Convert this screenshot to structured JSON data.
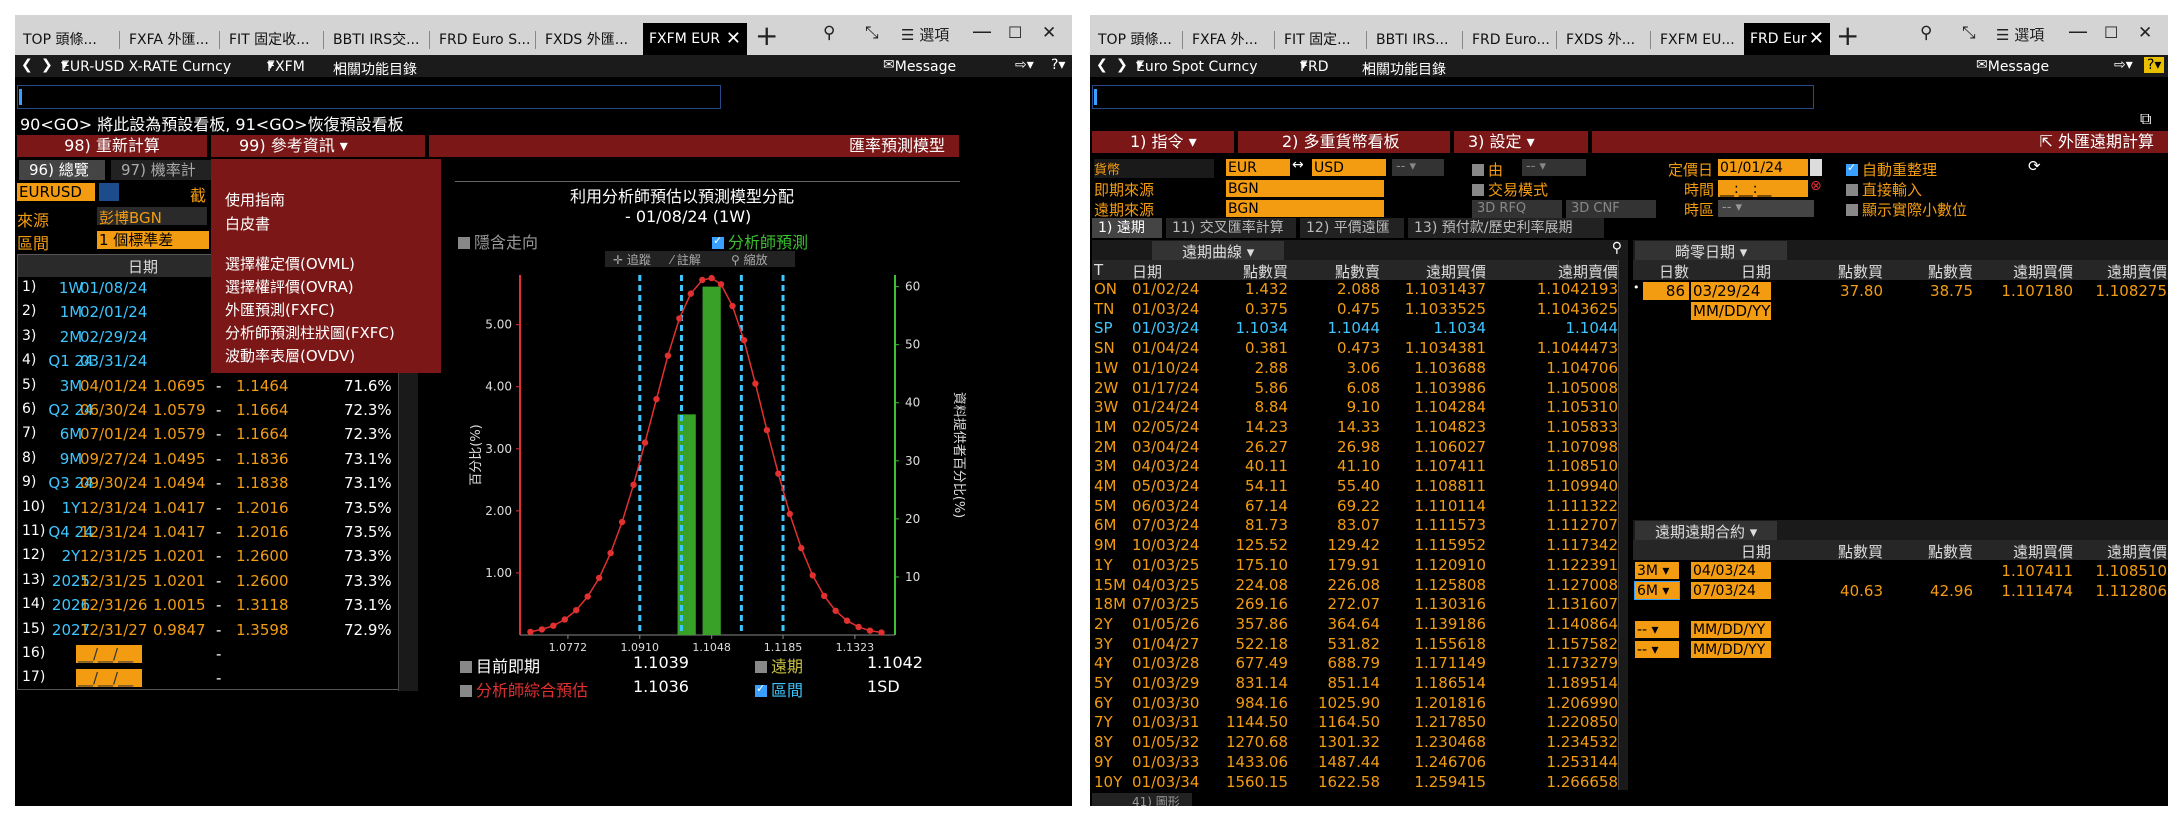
{
  "left": {
    "tabs": [
      "TOP 頭條...",
      "FXFA 外匯...",
      "FIT 固定收...",
      "BBTI IRS交...",
      "FRD Euro S...",
      "FXDS 外匯...",
      "FXFM EUR"
    ],
    "nav": {
      "security": "EUR-USD X-RATE Curncy",
      "function": "FXFM",
      "related": "相關功能目錄",
      "message": "Message"
    },
    "options_label": "選項",
    "hint": "90<GO> 將此設為預設看板, 91<GO>恢復預設看板",
    "menu": {
      "recalc": "98) 重新計算",
      "refinfo": "99) 參考資訊",
      "model": "匯率預測模型"
    },
    "subtabs": [
      "96) 總覽",
      "97) 機率計"
    ],
    "pair": "EURUSD",
    "pair_suffix": "截",
    "source_label": "來源",
    "source_value": "彭博BGN",
    "range_label": "區間",
    "range_value": "1 個標準差",
    "dropdown": [
      "使用指南",
      "白皮書",
      "選擇權定價(OVML)",
      "選擇權評價(OVRA)",
      "外匯預測(FXFC)",
      "分析師預測柱狀圖(FXFC)",
      "波動率表層(OVDV)"
    ],
    "table_header": "日期",
    "rows": [
      {
        "n": "1)",
        "t": "1W",
        "d": "01/08/24",
        "lo": "",
        "hi": "",
        "p": ""
      },
      {
        "n": "2)",
        "t": "1M",
        "d": "02/01/24",
        "lo": "",
        "hi": "",
        "p": ""
      },
      {
        "n": "3)",
        "t": "2M",
        "d": "02/29/24",
        "lo": "",
        "hi": "",
        "p": ""
      },
      {
        "n": "4)",
        "t": "Q1 24",
        "d": "03/31/24",
        "lo": "",
        "hi": "",
        "p": ""
      },
      {
        "n": "5)",
        "t": "3M",
        "d": "04/01/24",
        "lo": "1.0695",
        "hi": "1.1464",
        "p": "71.6%"
      },
      {
        "n": "6)",
        "t": "Q2 24",
        "d": "06/30/24",
        "lo": "1.0579",
        "hi": "1.1664",
        "p": "72.3%"
      },
      {
        "n": "7)",
        "t": "6M",
        "d": "07/01/24",
        "lo": "1.0579",
        "hi": "1.1664",
        "p": "72.3%"
      },
      {
        "n": "8)",
        "t": "9M",
        "d": "09/27/24",
        "lo": "1.0495",
        "hi": "1.1836",
        "p": "73.1%"
      },
      {
        "n": "9)",
        "t": "Q3 24",
        "d": "09/30/24",
        "lo": "1.0494",
        "hi": "1.1838",
        "p": "73.1%"
      },
      {
        "n": "10)",
        "t": "1Y",
        "d": "12/31/24",
        "lo": "1.0417",
        "hi": "1.2016",
        "p": "73.5%"
      },
      {
        "n": "11)",
        "t": "Q4 24",
        "d": "12/31/24",
        "lo": "1.0417",
        "hi": "1.2016",
        "p": "73.5%"
      },
      {
        "n": "12)",
        "t": "2Y",
        "d": "12/31/25",
        "lo": "1.0201",
        "hi": "1.2600",
        "p": "73.3%"
      },
      {
        "n": "13)",
        "t": "2025",
        "d": "12/31/25",
        "lo": "1.0201",
        "hi": "1.2600",
        "p": "73.3%"
      },
      {
        "n": "14)",
        "t": "2026",
        "d": "12/31/26",
        "lo": "1.0015",
        "hi": "1.3118",
        "p": "73.1%"
      },
      {
        "n": "15)",
        "t": "2027",
        "d": "12/31/27",
        "lo": "0.9847",
        "hi": "1.3598",
        "p": "72.9%"
      },
      {
        "n": "16)",
        "t": "",
        "d": "__/__/__",
        "lo": "",
        "hi": "-",
        "p": ""
      },
      {
        "n": "17)",
        "t": "",
        "d": "__/__/__",
        "lo": "",
        "hi": "-",
        "p": ""
      }
    ],
    "chart_toggle_hidden": "隱含走向",
    "chart_toggle_analyst": "分析師預測",
    "chart_tools": [
      "追蹤",
      "註解",
      "縮放"
    ],
    "legend": {
      "spot_label": "目前即期",
      "spot_value": "1.1039",
      "fwd_label": "遠期",
      "fwd_value": "1.1042",
      "analyst_label": "分析師綜合預估",
      "analyst_value": "1.1036",
      "range_label": "區間",
      "range_value": "1SD"
    }
  },
  "chart_data": {
    "type": "line",
    "title": "利用分析師預估以預測模型分配",
    "subtitle": "- 01/08/24 (1W)",
    "ylabel": "百分比(%)",
    "y2label": "資料提供者百分比(%)",
    "xticks": [
      "1.0772",
      "1.0910",
      "1.1048",
      "1.1185",
      "1.1323"
    ],
    "yticks": [
      "1.00",
      "2.00",
      "3.00",
      "4.00",
      "5.00"
    ],
    "y2ticks": [
      "10",
      "20",
      "30",
      "40",
      "50",
      "60"
    ],
    "ylim": [
      0,
      5.8
    ],
    "y2lim": [
      0,
      62
    ],
    "xlim": [
      1.068,
      1.14
    ],
    "series": [
      {
        "type": "line",
        "color": "#e03030",
        "x": [
          1.07,
          1.0722,
          1.0744,
          1.0766,
          1.0788,
          1.081,
          1.0832,
          1.0854,
          1.0876,
          1.0898,
          1.092,
          1.0942,
          1.0964,
          1.0986,
          1.1008,
          1.103,
          1.1048,
          1.1066,
          1.1088,
          1.111,
          1.1132,
          1.1154,
          1.1176,
          1.1198,
          1.122,
          1.1242,
          1.1264,
          1.1286,
          1.1308,
          1.133,
          1.1352,
          1.1374
        ],
        "y": [
          0.05,
          0.09,
          0.15,
          0.25,
          0.4,
          0.62,
          0.92,
          1.32,
          1.82,
          2.42,
          3.1,
          3.8,
          4.5,
          5.1,
          5.5,
          5.72,
          5.75,
          5.65,
          5.3,
          4.75,
          4.05,
          3.3,
          2.6,
          1.95,
          1.4,
          0.96,
          0.63,
          0.39,
          0.23,
          0.13,
          0.07,
          0.04
        ]
      },
      {
        "type": "bar",
        "color": "#3aa128",
        "x": [
          1.1,
          1.1048
        ],
        "y": [
          38,
          60
        ]
      }
    ],
    "vlines": [
      1.091,
      1.099,
      1.1105,
      1.1185
    ]
  },
  "right": {
    "tabs": [
      "TOP 頭條...",
      "FXFA 外...",
      "FIT 固定...",
      "BBTI IRS...",
      "FRD Euro...",
      "FXDS 外...",
      "FXFM EU...",
      "FRD Eur"
    ],
    "nav": {
      "security": "Euro Spot Curncy",
      "function": "FRD",
      "related": "相關功能目錄",
      "message": "Message"
    },
    "options_label": "選項",
    "menu": {
      "cmd": "1) 指令",
      "multi": "2) 多重貨幣看板",
      "settings": "3) 設定",
      "calc": "外匯遠期計算"
    },
    "form": {
      "currency_label": "貨幣",
      "ccy1": "EUR",
      "ccy2": "USD",
      "spot_src_label": "即期來源",
      "spot_src": "BGN",
      "fwd_src_label": "遠期來源",
      "fwd_src": "BGN",
      "from_label": "由",
      "trade_mode": "交易模式",
      "rfq": "3D RFQ",
      "cnf": "3D CNF",
      "price_date_label": "定價日",
      "price_date": "01/01/24",
      "time_label": "時間",
      "time_value": "__:__:__",
      "zone_label": "時區",
      "zone_value": "--",
      "auto_clean": "自動重整理",
      "direct_input": "直接輸入",
      "show_decimals": "顯示實際小數位"
    },
    "subtabs": [
      "1) 遠期",
      "11) 交叉匯率計算",
      "12) 平價遠匯",
      "13) 預付款/歷史利率展期"
    ],
    "curve_title": "遠期曲線",
    "cols": [
      "T",
      "日期",
      "點數買",
      "點數賣",
      "遠期買價",
      "遠期賣價"
    ],
    "rows": [
      [
        "ON",
        "01/02/24",
        "1.432",
        "2.088",
        "1.1031437",
        "1.1042193"
      ],
      [
        "TN",
        "01/03/24",
        "0.375",
        "0.475",
        "1.1033525",
        "1.1043625"
      ],
      [
        "SP",
        "01/03/24",
        "1.1034",
        "1.1044",
        "1.1034",
        "1.1044"
      ],
      [
        "SN",
        "01/04/24",
        "0.381",
        "0.473",
        "1.1034381",
        "1.1044473"
      ],
      [
        "1W",
        "01/10/24",
        "2.88",
        "3.06",
        "1.103688",
        "1.104706"
      ],
      [
        "2W",
        "01/17/24",
        "5.86",
        "6.08",
        "1.103986",
        "1.105008"
      ],
      [
        "3W",
        "01/24/24",
        "8.84",
        "9.10",
        "1.104284",
        "1.105310"
      ],
      [
        "1M",
        "02/05/24",
        "14.23",
        "14.33",
        "1.104823",
        "1.105833"
      ],
      [
        "2M",
        "03/04/24",
        "26.27",
        "26.98",
        "1.106027",
        "1.107098"
      ],
      [
        "3M",
        "04/03/24",
        "40.11",
        "41.10",
        "1.107411",
        "1.108510"
      ],
      [
        "4M",
        "05/03/24",
        "54.11",
        "55.40",
        "1.108811",
        "1.109940"
      ],
      [
        "5M",
        "06/03/24",
        "67.14",
        "69.22",
        "1.110114",
        "1.111322"
      ],
      [
        "6M",
        "07/03/24",
        "81.73",
        "83.07",
        "1.111573",
        "1.112707"
      ],
      [
        "9M",
        "10/03/24",
        "125.52",
        "129.42",
        "1.115952",
        "1.117342"
      ],
      [
        "1Y",
        "01/03/25",
        "175.10",
        "179.91",
        "1.120910",
        "1.122391"
      ],
      [
        "15M",
        "04/03/25",
        "224.08",
        "226.08",
        "1.125808",
        "1.127008"
      ],
      [
        "18M",
        "07/03/25",
        "269.16",
        "272.07",
        "1.130316",
        "1.131607"
      ],
      [
        "2Y",
        "01/05/26",
        "357.86",
        "364.64",
        "1.139186",
        "1.140864"
      ],
      [
        "3Y",
        "01/04/27",
        "522.18",
        "531.82",
        "1.155618",
        "1.157582"
      ],
      [
        "4Y",
        "01/03/28",
        "677.49",
        "688.79",
        "1.171149",
        "1.173279"
      ],
      [
        "5Y",
        "01/03/29",
        "831.14",
        "851.14",
        "1.186514",
        "1.189514"
      ],
      [
        "6Y",
        "01/03/30",
        "984.16",
        "1025.90",
        "1.201816",
        "1.206990"
      ],
      [
        "7Y",
        "01/03/31",
        "1144.50",
        "1164.50",
        "1.217850",
        "1.220850"
      ],
      [
        "8Y",
        "01/05/32",
        "1270.68",
        "1301.32",
        "1.230468",
        "1.234532"
      ],
      [
        "9Y",
        "01/03/33",
        "1433.06",
        "1487.44",
        "1.246706",
        "1.253144"
      ],
      [
        "10Y",
        "01/03/34",
        "1560.15",
        "1622.58",
        "1.259415",
        "1.266658"
      ]
    ],
    "broken_title": "畸零日期",
    "broken_cols": [
      "日數",
      "日期",
      "點數買",
      "點數賣",
      "遠期買價",
      "遠期賣價"
    ],
    "broken_row": [
      "86",
      "03/29/24",
      "37.80",
      "38.75",
      "1.107180",
      "1.108275"
    ],
    "broken_placeholder": "MM/DD/YY",
    "fwdfwd_title": "遠期遠期合約",
    "fwdfwd_col": "日期",
    "fwdfwd_cols": [
      "點數買",
      "點數賣",
      "遠期買價",
      "遠期賣價"
    ],
    "fwdfwd_rows": [
      [
        "3M",
        "04/03/24",
        "",
        "",
        "1.107411",
        "1.108510"
      ],
      [
        "6M",
        "07/03/24",
        "40.63",
        "42.96",
        "1.111474",
        "1.112806"
      ],
      [
        "--",
        "MM/DD/YY",
        "",
        "",
        "",
        ""
      ],
      [
        "--",
        "MM/DD/YY",
        "",
        "",
        "",
        ""
      ]
    ],
    "footer_label": "41) 圖形"
  }
}
